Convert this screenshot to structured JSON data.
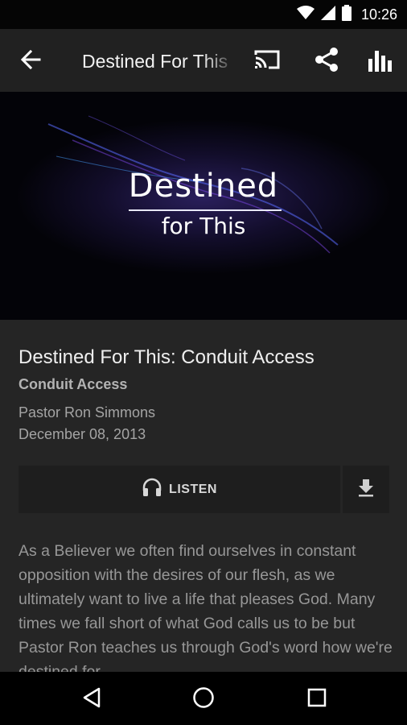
{
  "status_bar": {
    "time": "10:26",
    "icons": [
      "wifi-icon",
      "cell-signal-icon",
      "battery-icon"
    ]
  },
  "app_bar": {
    "title": "Destined For This",
    "icons": [
      "back-arrow-icon",
      "cast-icon",
      "share-icon",
      "stats-icon"
    ]
  },
  "hero": {
    "title": "Destined",
    "subtitle": "for This"
  },
  "sermon": {
    "title": "Destined For This: Conduit Access",
    "series": "Conduit Access",
    "speaker": "Pastor Ron Simmons",
    "date": "December 08, 2013",
    "listen_label": "LISTEN",
    "description": "As a Believer we often find ourselves in constant opposition with the desires of our flesh, as we ultimately want to live a life that pleases God. Many times we fall short of what God calls us to be but Pastor Ron teaches us through God's word how we're destined for"
  },
  "nav_bar": {
    "icons": [
      "back-triangle-icon",
      "home-circle-icon",
      "recents-square-icon"
    ]
  },
  "colors": {
    "background": "#252525",
    "app_bar": "#212121",
    "button": "#1e1e1e",
    "status_bar": "#050505"
  }
}
